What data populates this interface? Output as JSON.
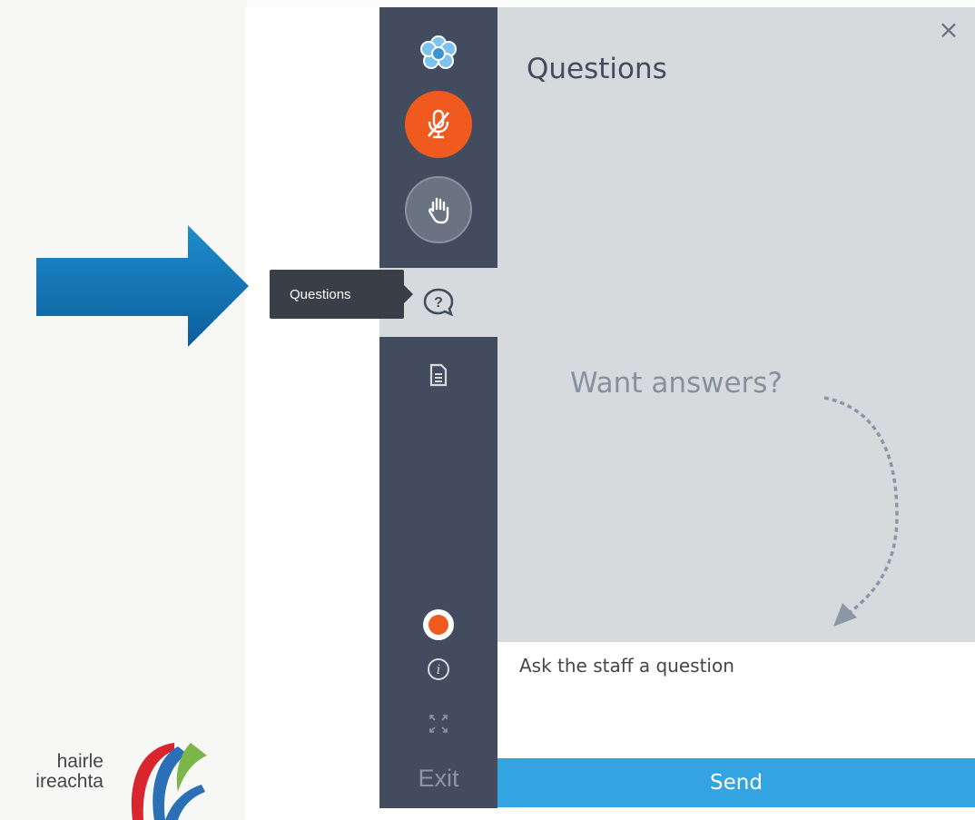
{
  "background": {
    "logo_line1": "hairle",
    "logo_line2": "ireachta"
  },
  "tooltip": {
    "label": "Questions"
  },
  "sidebar": {
    "app_logo_icon": "flower-logo-icon",
    "mic_icon": "microphone-muted-icon",
    "hand_icon": "raise-hand-icon",
    "questions_icon": "question-bubble-icon",
    "document_icon": "document-icon",
    "status_color": "#f15a1f",
    "info_icon": "info-icon",
    "expand_icon": "expand-icon",
    "exit_label": "Exit"
  },
  "panel": {
    "title": "Questions",
    "close_label": "×",
    "empty_hint": "Want answers?"
  },
  "compose": {
    "placeholder": "Ask the staff a question",
    "send_label": "Send"
  },
  "colors": {
    "accent_orange": "#f15a1f",
    "send_blue": "#34a3e1",
    "sidebar_bg": "#434c5e",
    "panel_bg": "#d7dadd"
  }
}
